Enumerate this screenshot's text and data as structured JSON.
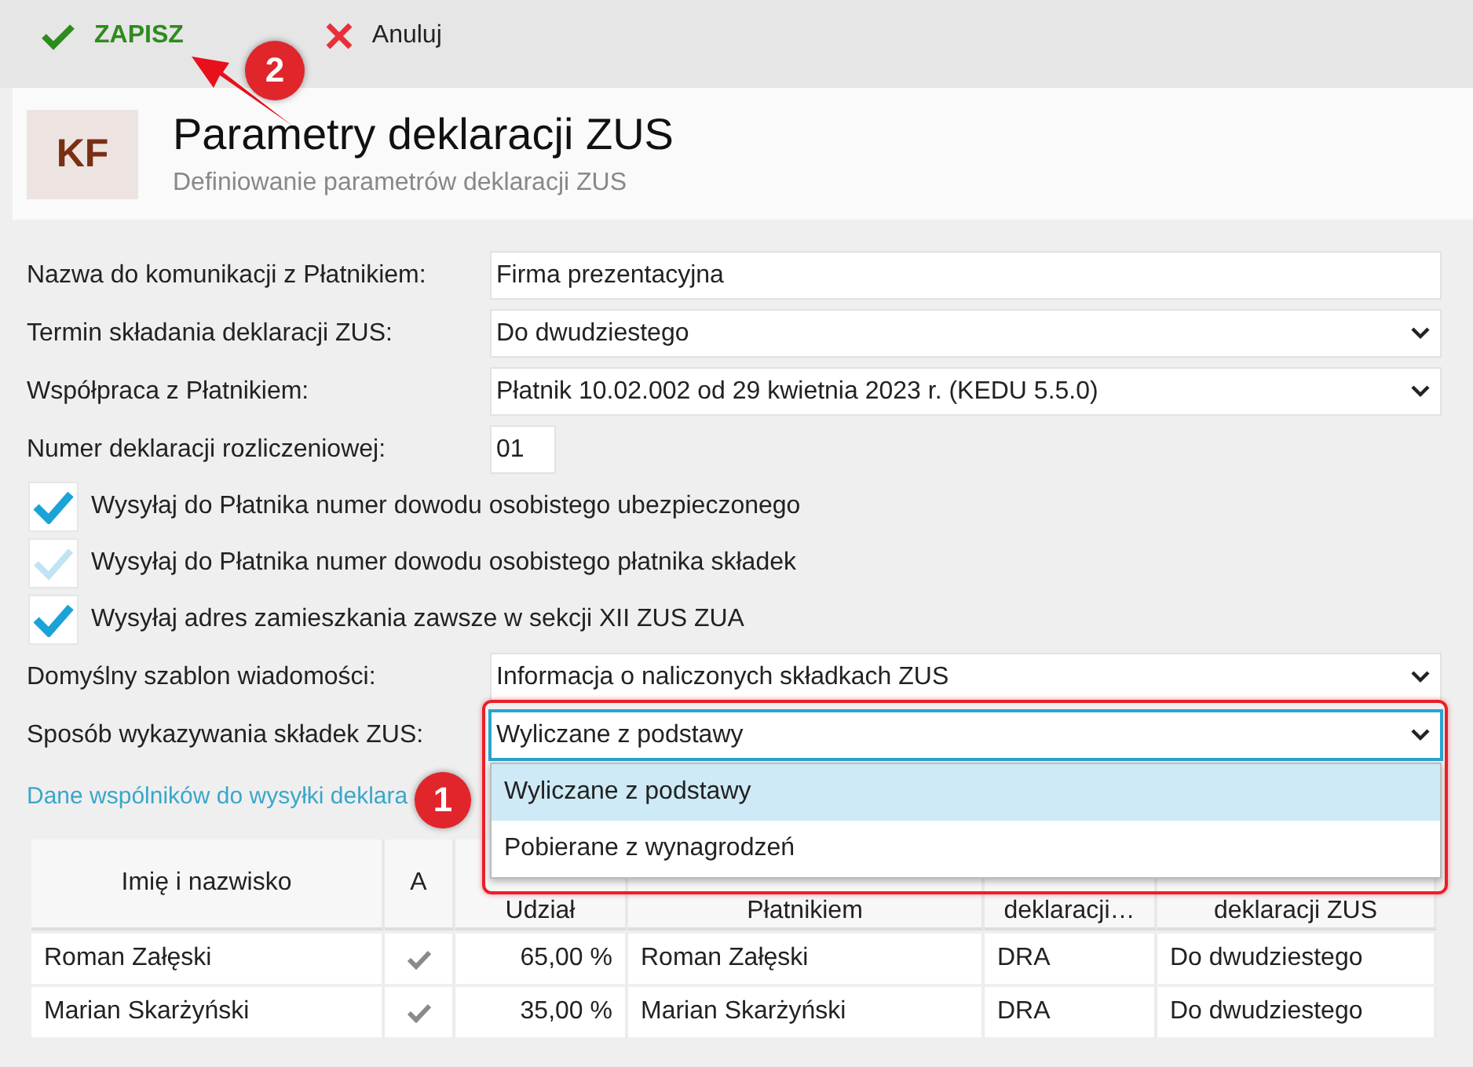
{
  "toolbar": {
    "buttons": [
      {
        "kind": "save",
        "label": "ZAPISZ"
      },
      {
        "kind": "cancel",
        "label": "Anuluj"
      }
    ]
  },
  "header": {
    "avatar": "KF",
    "title": "Parametry deklaracji ZUS",
    "subtitle": "Definiowanie parametrów deklaracji ZUS"
  },
  "form": [
    {
      "kind": "text",
      "label": "Nazwa do komunikacji z Płatnikiem:",
      "value": "Firma prezentacyjna"
    },
    {
      "kind": "select",
      "label": "Termin składania deklaracji ZUS:",
      "value": "Do dwudziestego"
    },
    {
      "kind": "select",
      "label": "Współpraca z Płatnikiem:",
      "value": "Płatnik 10.02.002 od 29 kwietnia 2023 r. (KEDU 5.5.0)"
    },
    {
      "kind": "short",
      "label": "Numer deklaracji rozliczeniowej:",
      "value": "01"
    },
    {
      "kind": "checkbox",
      "label": "Wysyłaj do Płatnika numer dowodu osobistego ubezpieczonego",
      "checked": true
    },
    {
      "kind": "checkbox",
      "label": "Wysyłaj do Płatnika numer dowodu osobistego płatnika składek",
      "checked": false
    },
    {
      "kind": "checkbox",
      "label": "Wysyłaj adres zamieszkania zawsze w sekcji XII ZUS ZUA",
      "checked": true
    },
    {
      "kind": "select",
      "label": "Domyślny szablon wiadomości:",
      "value": "Informacja o naliczonych składkach ZUS"
    },
    {
      "kind": "open-select",
      "label": "Sposób wykazywania składek ZUS:",
      "value": "Wyliczane z podstawy",
      "options": [
        {
          "label": "Wyliczane z podstawy",
          "selected": true
        },
        {
          "label": "Pobierane z wynagrodzeń",
          "selected": false
        }
      ]
    }
  ],
  "section_title": "Dane wspólników do wysyłki deklara",
  "table": {
    "columns": [
      "Imię i nazwisko",
      "A",
      "Udział",
      "Płatnikiem",
      "deklaracji…",
      "deklaracji ZUS"
    ],
    "rows": [
      {
        "name": "Roman Załęski",
        "active": true,
        "share": "65,00 %",
        "payer_name": "Roman Załęski",
        "declaration": "DRA",
        "term": "Do dwudziestego"
      },
      {
        "name": "Marian Skarżyński",
        "active": true,
        "share": "35,00 %",
        "payer_name": "Marian Skarżyński",
        "declaration": "DRA",
        "term": "Do dwudziestego"
      }
    ]
  },
  "annotations": [
    {
      "label": "2"
    },
    {
      "label": "1"
    }
  ]
}
